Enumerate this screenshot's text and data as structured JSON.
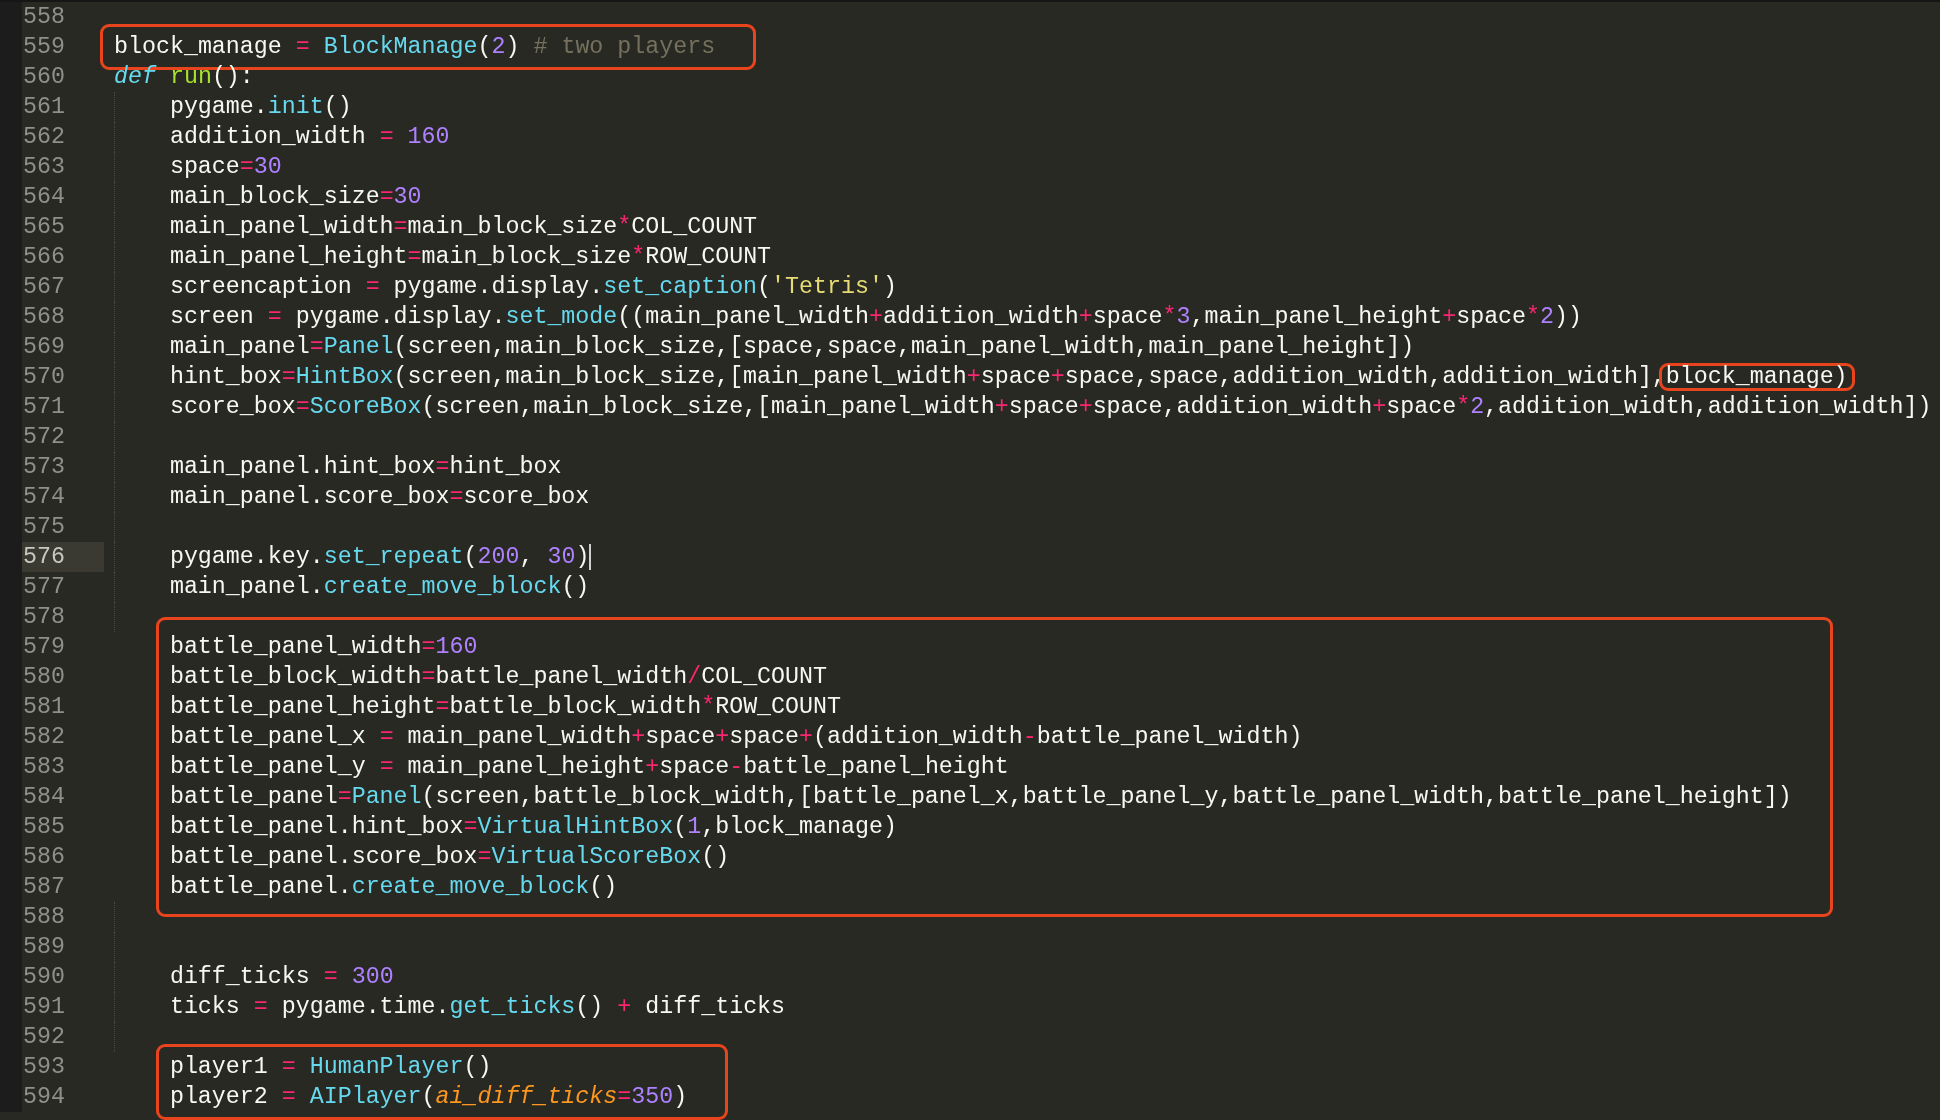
{
  "editor": {
    "sections": [
      {
        "boxed": false,
        "lines": [
          {
            "number": "558",
            "indented": false,
            "current": false
          }
        ]
      },
      {
        "boxed": true,
        "lines": [
          {
            "number": "559",
            "indented": false,
            "current": false,
            "tokens": [
              {
                "kind": "plain",
                "text": "block_manage "
              },
              {
                "kind": "operator",
                "text": "= "
              },
              {
                "kind": "call",
                "text": "BlockManage"
              },
              {
                "kind": "plain",
                "text": "("
              },
              {
                "kind": "number",
                "text": "2"
              },
              {
                "kind": "plain",
                "text": ") "
              },
              {
                "kind": "comment",
                "text": "# two players"
              }
            ]
          }
        ]
      },
      {
        "boxed": false,
        "lines": [
          {
            "number": "560",
            "indented": false,
            "current": false,
            "tokens": [
              {
                "kind": "keyword",
                "text": "def "
              },
              {
                "kind": "function",
                "text": "run"
              },
              {
                "kind": "plain",
                "text": "():"
              }
            ]
          },
          {
            "number": "561",
            "indented": true,
            "current": false,
            "tokens": [
              {
                "kind": "plain",
                "text": "pygame."
              },
              {
                "kind": "call",
                "text": "init"
              },
              {
                "kind": "plain",
                "text": "()"
              }
            ]
          },
          {
            "number": "562",
            "indented": true,
            "current": false,
            "tokens": [
              {
                "kind": "plain",
                "text": "addition_width "
              },
              {
                "kind": "operator",
                "text": "= "
              },
              {
                "kind": "number",
                "text": "160"
              }
            ]
          },
          {
            "number": "563",
            "indented": true,
            "current": false,
            "tokens": [
              {
                "kind": "plain",
                "text": "space"
              },
              {
                "kind": "operator",
                "text": "="
              },
              {
                "kind": "number",
                "text": "30"
              }
            ]
          },
          {
            "number": "564",
            "indented": true,
            "current": false,
            "tokens": [
              {
                "kind": "plain",
                "text": "main_block_size"
              },
              {
                "kind": "operator",
                "text": "="
              },
              {
                "kind": "number",
                "text": "30"
              }
            ]
          },
          {
            "number": "565",
            "indented": true,
            "current": false,
            "tokens": [
              {
                "kind": "plain",
                "text": "main_panel_width"
              },
              {
                "kind": "operator",
                "text": "="
              },
              {
                "kind": "plain",
                "text": "main_block_size"
              },
              {
                "kind": "operator",
                "text": "*"
              },
              {
                "kind": "plain",
                "text": "COL_COUNT"
              }
            ]
          },
          {
            "number": "566",
            "indented": true,
            "current": false,
            "tokens": [
              {
                "kind": "plain",
                "text": "main_panel_height"
              },
              {
                "kind": "operator",
                "text": "="
              },
              {
                "kind": "plain",
                "text": "main_block_size"
              },
              {
                "kind": "operator",
                "text": "*"
              },
              {
                "kind": "plain",
                "text": "ROW_COUNT"
              }
            ]
          },
          {
            "number": "567",
            "indented": true,
            "current": false,
            "tokens": [
              {
                "kind": "plain",
                "text": "screencaption "
              },
              {
                "kind": "operator",
                "text": "="
              },
              {
                "kind": "plain",
                "text": " pygame.display."
              },
              {
                "kind": "call",
                "text": "set_caption"
              },
              {
                "kind": "plain",
                "text": "("
              },
              {
                "kind": "string",
                "text": "'Tetris'"
              },
              {
                "kind": "plain",
                "text": ")"
              }
            ]
          },
          {
            "number": "568",
            "indented": true,
            "current": false,
            "tokens": [
              {
                "kind": "plain",
                "text": "screen "
              },
              {
                "kind": "operator",
                "text": "="
              },
              {
                "kind": "plain",
                "text": " pygame.display."
              },
              {
                "kind": "call",
                "text": "set_mode"
              },
              {
                "kind": "plain",
                "text": "((main_panel_width"
              },
              {
                "kind": "operator",
                "text": "+"
              },
              {
                "kind": "plain",
                "text": "addition_width"
              },
              {
                "kind": "operator",
                "text": "+"
              },
              {
                "kind": "plain",
                "text": "space"
              },
              {
                "kind": "operator",
                "text": "*"
              },
              {
                "kind": "number",
                "text": "3"
              },
              {
                "kind": "plain",
                "text": ",main_panel_height"
              },
              {
                "kind": "operator",
                "text": "+"
              },
              {
                "kind": "plain",
                "text": "space"
              },
              {
                "kind": "operator",
                "text": "*"
              },
              {
                "kind": "number",
                "text": "2"
              },
              {
                "kind": "plain",
                "text": "))"
              }
            ]
          },
          {
            "number": "569",
            "indented": true,
            "current": false,
            "tokens": [
              {
                "kind": "plain",
                "text": "main_panel"
              },
              {
                "kind": "operator",
                "text": "="
              },
              {
                "kind": "call",
                "text": "Panel"
              },
              {
                "kind": "plain",
                "text": "(screen,main_block_size,[space,space,main_panel_width,main_panel_height])"
              }
            ]
          },
          {
            "number": "570",
            "indented": true,
            "current": false,
            "tokens": [
              {
                "kind": "plain",
                "text": "hint_box"
              },
              {
                "kind": "operator",
                "text": "="
              },
              {
                "kind": "call",
                "text": "HintBox"
              },
              {
                "kind": "plain",
                "text": "(screen,main_block_size,[main_panel_width"
              },
              {
                "kind": "operator",
                "text": "+"
              },
              {
                "kind": "plain",
                "text": "space"
              },
              {
                "kind": "operator",
                "text": "+"
              },
              {
                "kind": "plain",
                "text": "space,space,addition_width,addition_width],"
              },
              {
                "kind": "plain",
                "text": "block_manage)",
                "boxed": true
              }
            ]
          },
          {
            "number": "571",
            "indented": true,
            "current": false,
            "tokens": [
              {
                "kind": "plain",
                "text": "score_box"
              },
              {
                "kind": "operator",
                "text": "="
              },
              {
                "kind": "call",
                "text": "ScoreBox"
              },
              {
                "kind": "plain",
                "text": "(screen,main_block_size,[main_panel_width"
              },
              {
                "kind": "operator",
                "text": "+"
              },
              {
                "kind": "plain",
                "text": "space"
              },
              {
                "kind": "operator",
                "text": "+"
              },
              {
                "kind": "plain",
                "text": "space,addition_width"
              },
              {
                "kind": "operator",
                "text": "+"
              },
              {
                "kind": "plain",
                "text": "space"
              },
              {
                "kind": "operator",
                "text": "*"
              },
              {
                "kind": "number",
                "text": "2"
              },
              {
                "kind": "plain",
                "text": ",addition_width,addition_width])"
              }
            ]
          },
          {
            "number": "572",
            "indented": true,
            "current": false
          },
          {
            "number": "573",
            "indented": true,
            "current": false,
            "tokens": [
              {
                "kind": "plain",
                "text": "main_panel.hint_box"
              },
              {
                "kind": "operator",
                "text": "="
              },
              {
                "kind": "plain",
                "text": "hint_box"
              }
            ]
          },
          {
            "number": "574",
            "indented": true,
            "current": false,
            "tokens": [
              {
                "kind": "plain",
                "text": "main_panel.score_box"
              },
              {
                "kind": "operator",
                "text": "="
              },
              {
                "kind": "plain",
                "text": "score_box"
              }
            ]
          },
          {
            "number": "575",
            "indented": true,
            "current": false
          },
          {
            "number": "576",
            "indented": true,
            "current": true,
            "tokens": [
              {
                "kind": "plain",
                "text": "pygame.key."
              },
              {
                "kind": "call",
                "text": "set_repeat"
              },
              {
                "kind": "plain",
                "text": "("
              },
              {
                "kind": "number",
                "text": "200"
              },
              {
                "kind": "plain",
                "text": ", "
              },
              {
                "kind": "number",
                "text": "30"
              },
              {
                "kind": "plain",
                "text": ")"
              }
            ]
          },
          {
            "number": "577",
            "indented": true,
            "current": false,
            "tokens": [
              {
                "kind": "plain",
                "text": "main_panel."
              },
              {
                "kind": "call",
                "text": "create_move_block"
              },
              {
                "kind": "plain",
                "text": "()"
              }
            ]
          },
          {
            "number": "578",
            "indented": true,
            "current": false
          }
        ]
      },
      {
        "boxed": true,
        "lines": [
          {
            "number": "579",
            "indented": true,
            "current": false,
            "tokens": [
              {
                "kind": "plain",
                "text": "battle_panel_width"
              },
              {
                "kind": "operator",
                "text": "="
              },
              {
                "kind": "number",
                "text": "160"
              }
            ]
          },
          {
            "number": "580",
            "indented": true,
            "current": false,
            "tokens": [
              {
                "kind": "plain",
                "text": "battle_block_width"
              },
              {
                "kind": "operator",
                "text": "="
              },
              {
                "kind": "plain",
                "text": "battle_panel_width"
              },
              {
                "kind": "operator",
                "text": "/"
              },
              {
                "kind": "plain",
                "text": "COL_COUNT"
              }
            ]
          },
          {
            "number": "581",
            "indented": true,
            "current": false,
            "tokens": [
              {
                "kind": "plain",
                "text": "battle_panel_height"
              },
              {
                "kind": "operator",
                "text": "="
              },
              {
                "kind": "plain",
                "text": "battle_block_width"
              },
              {
                "kind": "operator",
                "text": "*"
              },
              {
                "kind": "plain",
                "text": "ROW_COUNT"
              }
            ]
          },
          {
            "number": "582",
            "indented": true,
            "current": false,
            "tokens": [
              {
                "kind": "plain",
                "text": "battle_panel_x "
              },
              {
                "kind": "operator",
                "text": "="
              },
              {
                "kind": "plain",
                "text": " main_panel_width"
              },
              {
                "kind": "operator",
                "text": "+"
              },
              {
                "kind": "plain",
                "text": "space"
              },
              {
                "kind": "operator",
                "text": "+"
              },
              {
                "kind": "plain",
                "text": "space"
              },
              {
                "kind": "operator",
                "text": "+"
              },
              {
                "kind": "plain",
                "text": "(addition_width"
              },
              {
                "kind": "operator",
                "text": "-"
              },
              {
                "kind": "plain",
                "text": "battle_panel_width)"
              }
            ]
          },
          {
            "number": "583",
            "indented": true,
            "current": false,
            "tokens": [
              {
                "kind": "plain",
                "text": "battle_panel_y "
              },
              {
                "kind": "operator",
                "text": "="
              },
              {
                "kind": "plain",
                "text": " main_panel_height"
              },
              {
                "kind": "operator",
                "text": "+"
              },
              {
                "kind": "plain",
                "text": "space"
              },
              {
                "kind": "operator",
                "text": "-"
              },
              {
                "kind": "plain",
                "text": "battle_panel_height"
              }
            ]
          },
          {
            "number": "584",
            "indented": true,
            "current": false,
            "tokens": [
              {
                "kind": "plain",
                "text": "battle_panel"
              },
              {
                "kind": "operator",
                "text": "="
              },
              {
                "kind": "call",
                "text": "Panel"
              },
              {
                "kind": "plain",
                "text": "(screen,battle_block_width,[battle_panel_x,battle_panel_y,battle_panel_width,battle_panel_height])"
              }
            ]
          },
          {
            "number": "585",
            "indented": true,
            "current": false,
            "tokens": [
              {
                "kind": "plain",
                "text": "battle_panel.hint_box"
              },
              {
                "kind": "operator",
                "text": "="
              },
              {
                "kind": "call",
                "text": "VirtualHintBox"
              },
              {
                "kind": "plain",
                "text": "("
              },
              {
                "kind": "number",
                "text": "1"
              },
              {
                "kind": "plain",
                "text": ",block_manage)"
              }
            ]
          },
          {
            "number": "586",
            "indented": true,
            "current": false,
            "tokens": [
              {
                "kind": "plain",
                "text": "battle_panel.score_box"
              },
              {
                "kind": "operator",
                "text": "="
              },
              {
                "kind": "call",
                "text": "VirtualScoreBox"
              },
              {
                "kind": "plain",
                "text": "()"
              }
            ]
          },
          {
            "number": "587",
            "indented": true,
            "current": false,
            "tokens": [
              {
                "kind": "plain",
                "text": "battle_panel."
              },
              {
                "kind": "call",
                "text": "create_move_block"
              },
              {
                "kind": "plain",
                "text": "()"
              }
            ]
          }
        ]
      },
      {
        "boxed": false,
        "lines": [
          {
            "number": "588",
            "indented": true,
            "current": false
          },
          {
            "number": "589",
            "indented": true,
            "current": false
          },
          {
            "number": "590",
            "indented": true,
            "current": false,
            "tokens": [
              {
                "kind": "plain",
                "text": "diff_ticks "
              },
              {
                "kind": "operator",
                "text": "= "
              },
              {
                "kind": "number",
                "text": "300"
              }
            ]
          },
          {
            "number": "591",
            "indented": true,
            "current": false,
            "tokens": [
              {
                "kind": "plain",
                "text": "ticks "
              },
              {
                "kind": "operator",
                "text": "="
              },
              {
                "kind": "plain",
                "text": " pygame.time."
              },
              {
                "kind": "call",
                "text": "get_ticks"
              },
              {
                "kind": "plain",
                "text": "() "
              },
              {
                "kind": "operator",
                "text": "+"
              },
              {
                "kind": "plain",
                "text": " diff_ticks"
              }
            ]
          },
          {
            "number": "592",
            "indented": true,
            "current": false
          }
        ]
      },
      {
        "boxed": true,
        "lines": [
          {
            "number": "593",
            "indented": true,
            "current": false,
            "tokens": [
              {
                "kind": "plain",
                "text": "player1 "
              },
              {
                "kind": "operator",
                "text": "= "
              },
              {
                "kind": "call",
                "text": "HumanPlayer"
              },
              {
                "kind": "plain",
                "text": "()"
              }
            ]
          },
          {
            "number": "594",
            "indented": true,
            "current": false,
            "tokens": [
              {
                "kind": "plain",
                "text": "player2 "
              },
              {
                "kind": "operator",
                "text": "= "
              },
              {
                "kind": "call",
                "text": "AIPlayer"
              },
              {
                "kind": "plain",
                "text": "("
              },
              {
                "kind": "parameter",
                "text": "ai_diff_ticks"
              },
              {
                "kind": "operator",
                "text": "="
              },
              {
                "kind": "number",
                "text": "350"
              },
              {
                "kind": "plain",
                "text": ")"
              }
            ]
          }
        ]
      }
    ]
  }
}
